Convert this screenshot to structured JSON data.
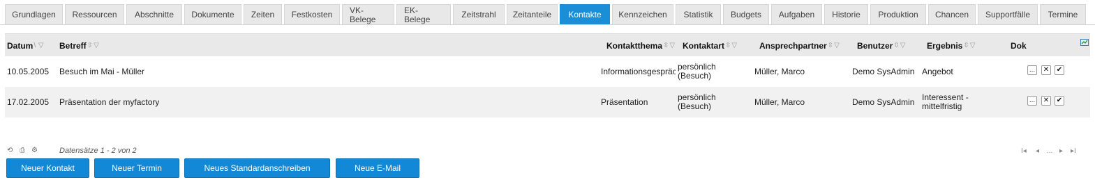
{
  "tabs": [
    {
      "label": "Grundlagen"
    },
    {
      "label": "Ressourcen"
    },
    {
      "label": "Abschnitte"
    },
    {
      "label": "Dokumente"
    },
    {
      "label": "Zeiten"
    },
    {
      "label": "Festkosten"
    },
    {
      "label": "VK-\nBelege"
    },
    {
      "label": "EK-\nBelege"
    },
    {
      "label": "Zeitstrahl"
    },
    {
      "label": "Zeitanteile"
    },
    {
      "label": "Kontakte"
    },
    {
      "label": "Kennzeichen"
    },
    {
      "label": "Statistik"
    },
    {
      "label": "Budgets"
    },
    {
      "label": "Aufgaben"
    },
    {
      "label": "Historie"
    },
    {
      "label": "Produktion"
    },
    {
      "label": "Chancen"
    },
    {
      "label": "Supportfälle"
    },
    {
      "label": "Termine"
    }
  ],
  "active_tab": "Kontakte",
  "columns": {
    "datum": "Datum",
    "betreff": "Betreff",
    "kontaktthema": "Kontaktthema",
    "kontaktart": "Kontaktart",
    "ansprechpartner": "Ansprechpartner",
    "benutzer": "Benutzer",
    "ergebnis": "Ergebnis",
    "dok": "Dok"
  },
  "rows": [
    {
      "datum": "10.05.2005",
      "betreff": "Besuch im Mai - Müller",
      "kontaktthema": "Informationsgespräch",
      "kontaktart": "persönlich (Besuch)",
      "ansprechpartner": "Müller, Marco",
      "benutzer": "Demo SysAdmin",
      "ergebnis": "Angebot"
    },
    {
      "datum": "17.02.2005",
      "betreff": "Präsentation der myfactory",
      "kontaktthema": "Präsentation",
      "kontaktart": "persönlich (Besuch)",
      "ansprechpartner": "Müller, Marco",
      "benutzer": "Demo SysAdmin",
      "ergebnis": "Interessent - mittelfristig"
    }
  ],
  "row_buttons": {
    "more": "...",
    "delete": "✕",
    "confirm": "✔"
  },
  "footer": {
    "records": "Datensätze 1 - 2 von 2",
    "pager": {
      "first": "I◂",
      "prev": "◂",
      "ellipsis": "...",
      "next": "▸",
      "last": "▸I"
    }
  },
  "buttons": {
    "new_contact": "Neuer Kontakt",
    "new_appointment": "Neuer Termin",
    "new_standard_letter": "Neues Standardanschreiben",
    "new_email": "Neue E-Mail"
  },
  "colors": {
    "accent": "#1a8fd8",
    "button": "#1288d6",
    "header_bg": "#e9e9e9"
  }
}
